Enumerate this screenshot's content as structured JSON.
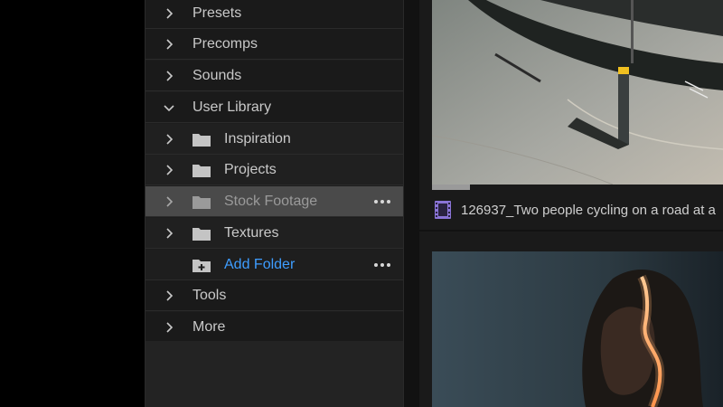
{
  "library": {
    "items": [
      {
        "label": "Presets",
        "expanded": false
      },
      {
        "label": "Precomps",
        "expanded": false
      },
      {
        "label": "Sounds",
        "expanded": false
      },
      {
        "label": "User Library",
        "expanded": true
      },
      {
        "label": "Inspiration",
        "expanded": false
      },
      {
        "label": "Projects",
        "expanded": false
      },
      {
        "label": "Stock Footage",
        "expanded": false,
        "selected": true
      },
      {
        "label": "Textures",
        "expanded": false
      },
      {
        "label": "Add Folder"
      },
      {
        "label": "Tools",
        "expanded": false
      },
      {
        "label": "More",
        "expanded": false
      }
    ],
    "add_folder_color": "#3e9dff"
  },
  "clips": [
    {
      "title": "126937_Two people cycling on a road at a",
      "icon": "film-clip-icon",
      "progress": 0.13
    },
    {
      "title": ""
    }
  ],
  "colors": {
    "panel_bg": "#1d1d1d",
    "selected_row": "#4a4a4a",
    "clip_icon": "#8a74d6"
  }
}
